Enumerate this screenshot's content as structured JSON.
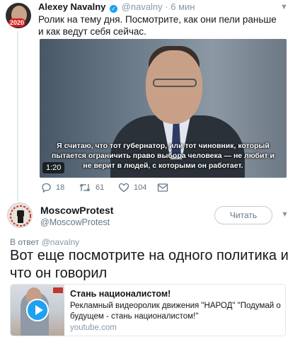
{
  "tweet1": {
    "name": "Alexey Navalny",
    "handle": "@navalny",
    "time": "6 мин",
    "badge": "2020",
    "text": "Ролик на тему дня. Посмотрите, как они пели раньше и как ведут себя сейчас.",
    "video": {
      "caption": "Я считаю, что тот губернатор, или тот чиновник, который пытается ограничить право выбора человека — не любит и не верит в людей, с которыми он работает.",
      "time": "1:20"
    },
    "actions": {
      "replies": "18",
      "retweets": "61",
      "likes": "104"
    }
  },
  "tweet2": {
    "name": "MoscowProtest",
    "handle": "@MoscowProtest",
    "follow_label": "Читать",
    "reply_prefix": "В ответ",
    "reply_handle": "@navalny",
    "text": "Вот еще посмотрите на одного политика и что он говорил",
    "card": {
      "title": "Стань националистом!",
      "description": "Рекламный видеоролик движения \"НАРОД\" \"Подумай о будущем - стань националистом!\"",
      "domain": "youtube.com"
    }
  },
  "colors": {
    "accent": "#1da1f2",
    "muted": "#657786",
    "text": "#14171a"
  },
  "icons": [
    "chevron-down-icon",
    "verified-icon",
    "reply-icon",
    "retweet-icon",
    "like-icon",
    "message-icon",
    "play-icon"
  ]
}
